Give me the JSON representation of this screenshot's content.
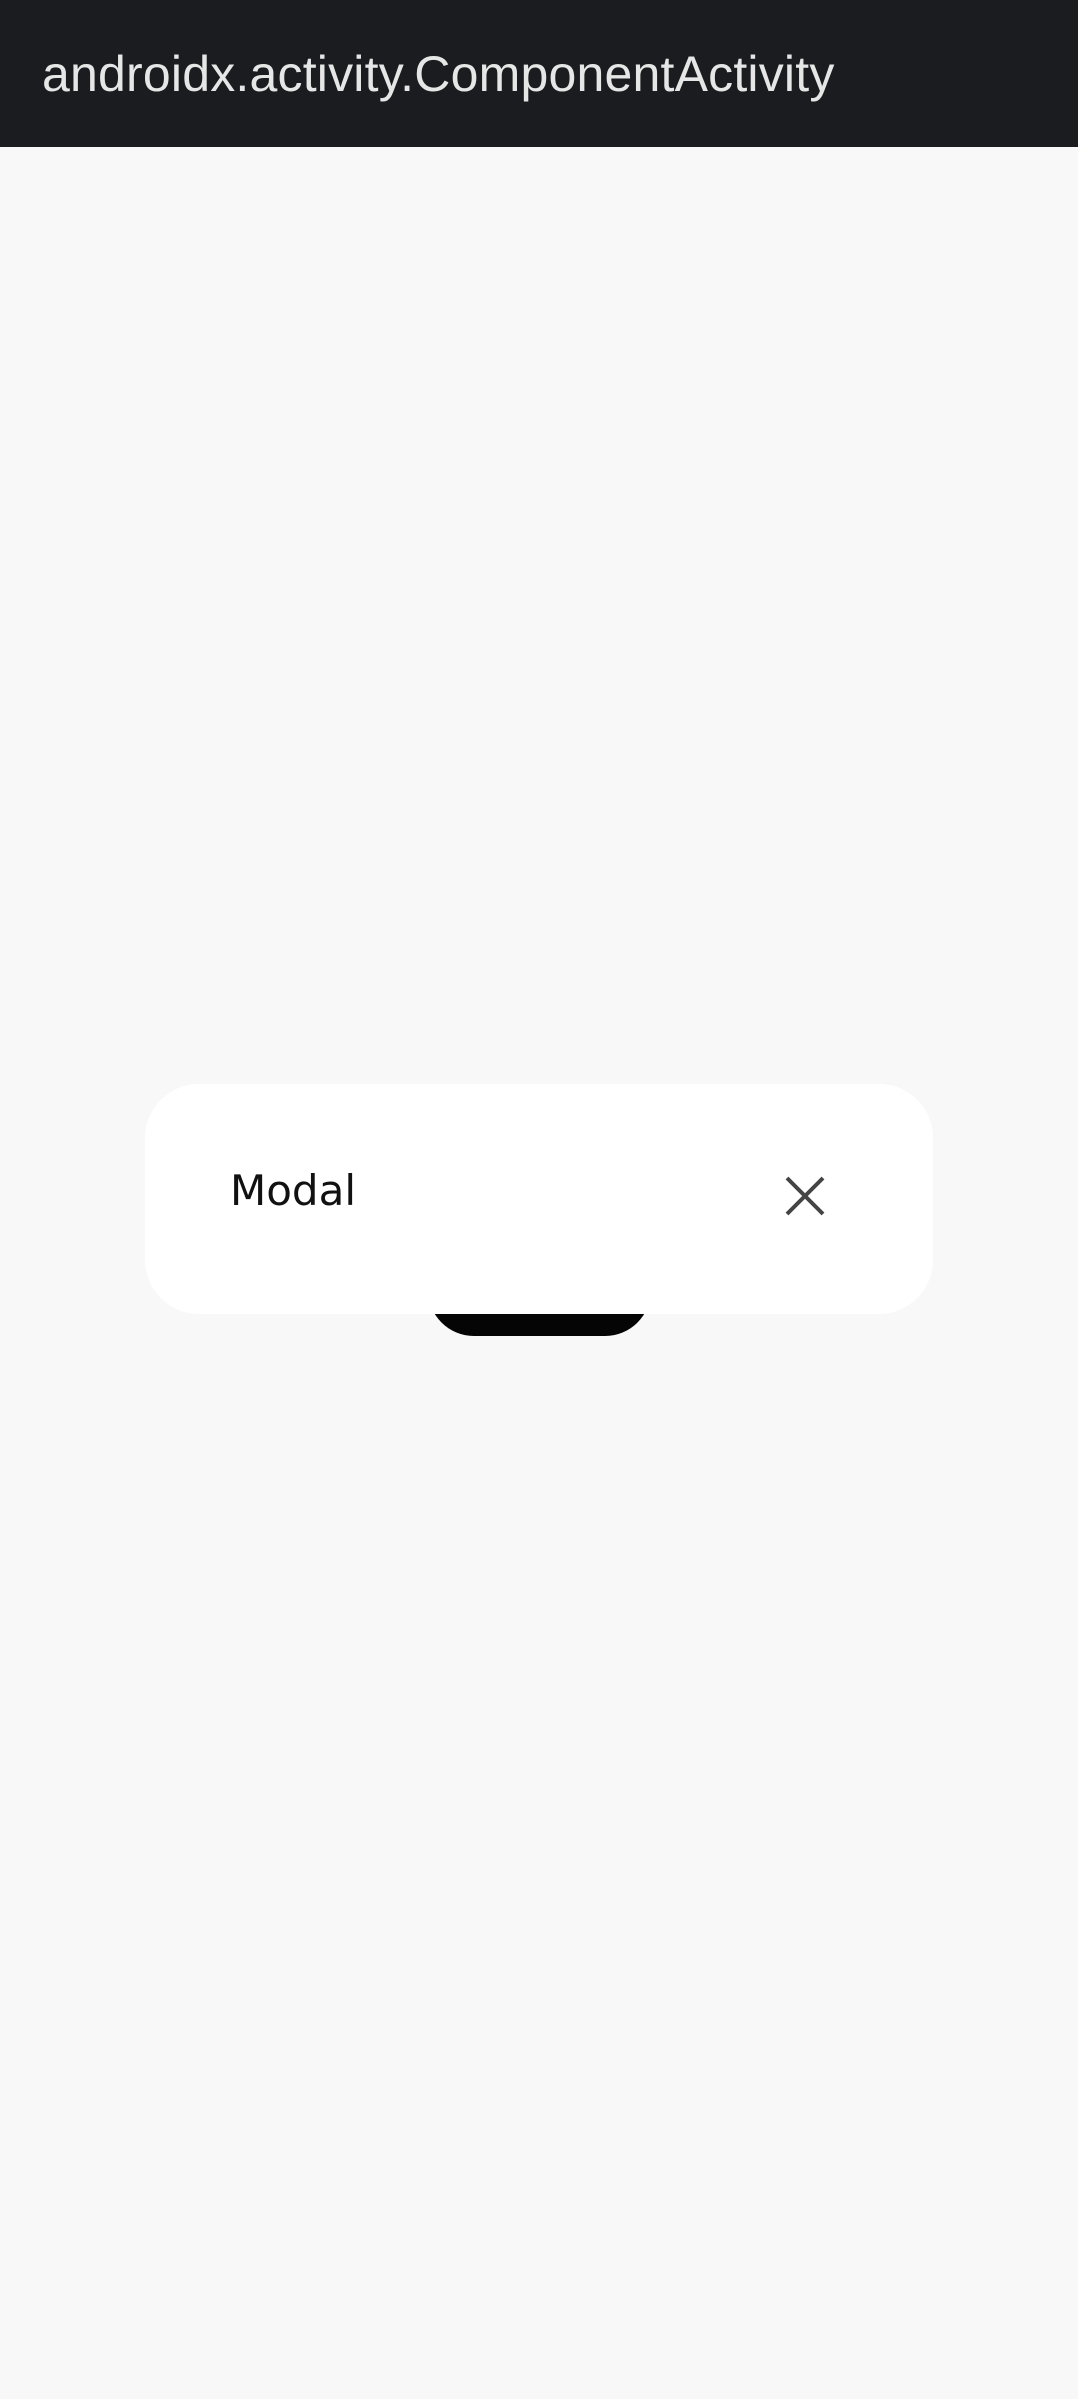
{
  "app_bar": {
    "title": "androidx.activity.ComponentActivity"
  },
  "modal": {
    "title": "Modal",
    "close_icon": "close-icon"
  },
  "colors": {
    "app_bar_bg": "#1A1C1F",
    "app_bar_text": "#E6E6E6",
    "content_bg": "#F8F8F8",
    "modal_bg": "#FFFFFF",
    "background_button": "#050505",
    "close_icon": "#444444"
  }
}
